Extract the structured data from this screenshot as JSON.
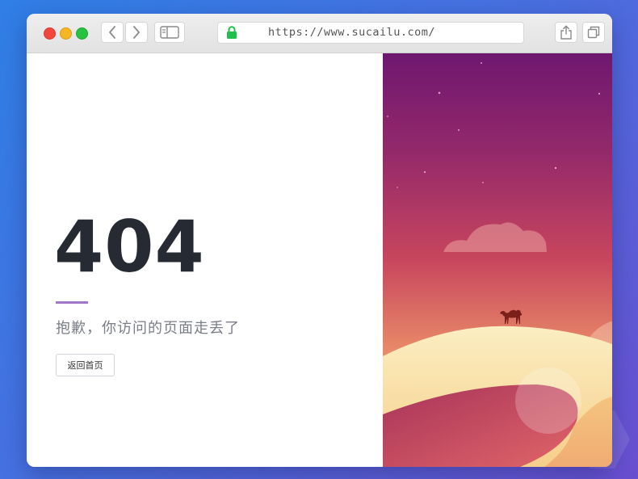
{
  "browser": {
    "url": "https://www.sucailu.com/",
    "buttons": {
      "back": "chevron-left-icon",
      "forward": "chevron-right-icon",
      "sidebar": "sidebar-icon",
      "share": "share-icon",
      "tabs": "tabs-icon"
    },
    "lock_icon": "lock-icon",
    "traffic_lights": [
      "#f2453d",
      "#f5b623",
      "#27c23f"
    ]
  },
  "error_page": {
    "code": "404",
    "message": "抱歉，你访问的页面走丢了",
    "home_button_label": "返回首页",
    "accent_color": "#a077c6"
  },
  "illustration": {
    "icons": [
      "camel-icon",
      "cloud-icon",
      "moon-icon"
    ],
    "colors": {
      "sky_top": "#6e1770",
      "sky_mid": "#c8465d",
      "sky_bottom": "#f6c77a"
    }
  }
}
